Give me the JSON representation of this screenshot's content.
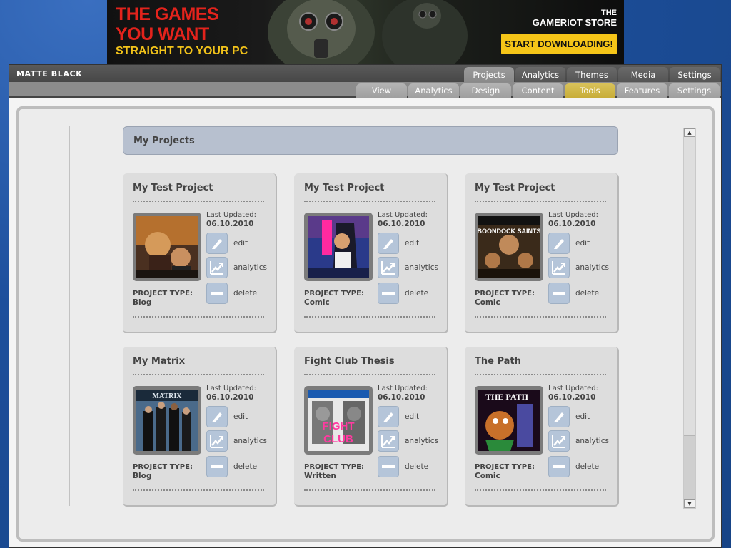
{
  "banner": {
    "line1": "THE GAMES",
    "line2": "YOU WANT",
    "line3": "STRAIGHT TO YOUR PC",
    "store_the": "THE",
    "store_name": "GAMERIOT STORE",
    "cta": "START DOWNLOADING!"
  },
  "app": {
    "title": "MATTE BLACK",
    "main_tabs": [
      {
        "label": "Projects",
        "active": true
      },
      {
        "label": "Analytics"
      },
      {
        "label": "Themes"
      },
      {
        "label": "Media"
      },
      {
        "label": "Settings"
      }
    ],
    "sub_tabs": [
      {
        "label": "View"
      },
      {
        "label": "Analytics"
      },
      {
        "label": "Design"
      },
      {
        "label": "Content"
      },
      {
        "label": "Tools",
        "active": true
      },
      {
        "label": "Features"
      },
      {
        "label": "Settings"
      }
    ]
  },
  "section": {
    "title": "My Projects"
  },
  "labels": {
    "last_updated": "Last Updated:",
    "project_type": "PROJECT TYPE:",
    "edit": "edit",
    "analytics": "analytics",
    "delete": "delete"
  },
  "projects": [
    {
      "title": "My Test Project",
      "date": "06.10.2010",
      "type": "Blog"
    },
    {
      "title": "My Test Project",
      "date": "06.10.2010",
      "type": "Comic"
    },
    {
      "title": "My Test Project",
      "date": "06.10.2010",
      "type": "Comic"
    },
    {
      "title": "My Matrix",
      "date": "06.10.2010",
      "type": "Blog"
    },
    {
      "title": "Fight Club Thesis",
      "date": "06.10.2010",
      "type": "Written"
    },
    {
      "title": "The Path",
      "date": "06.10.2010",
      "type": "Comic"
    }
  ],
  "thumbnail_text": {
    "p3_top": "BOONDOCK SAINTS",
    "p4_top": "MATRIX",
    "p5_top": "FIGHT",
    "p5_bottom": "CLUB",
    "p6_top": "THE PATH"
  },
  "colors": {
    "accent_tab": "#c8ad38",
    "header_blue": "#b7c0cf",
    "icon_blue": "#b5c5d9",
    "banner_red": "#e3231c",
    "banner_yellow": "#f5c518"
  }
}
